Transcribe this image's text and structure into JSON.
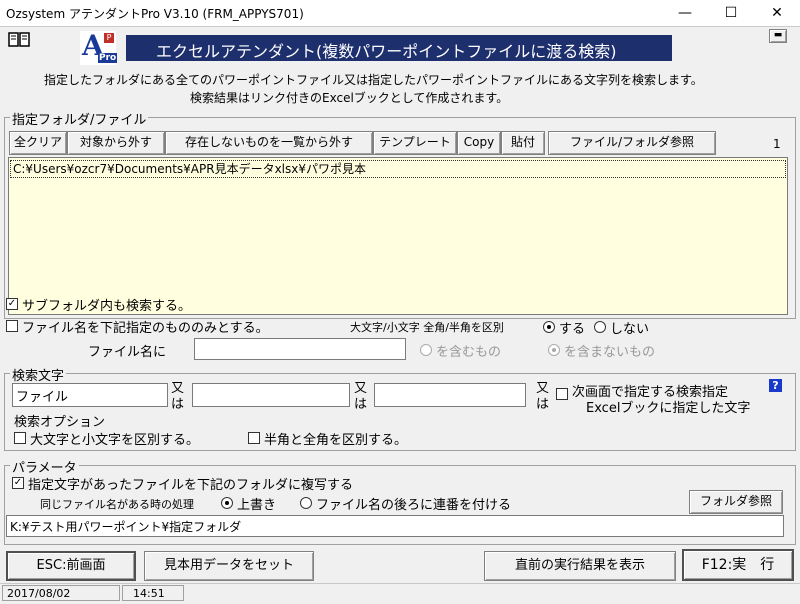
{
  "window": {
    "title": "Ozsystem アテンダントPro V3.10 (FRM_APPYS701)"
  },
  "header": {
    "logo_letter": "A",
    "logo_sub": "Pro",
    "banner": "エクセルアテンダント(複数パワーポイントファイルに渡る検索)",
    "desc1": "指定したフォルダにある全てのパワーポイントファイル又は指定したパワーポイントファイルにある文字列を検索します。",
    "desc2": "検索結果はリンク付きのExcelブックとして作成されます。"
  },
  "folder_group": {
    "label": "指定フォルダ/ファイル",
    "buttons": [
      "全クリア",
      "対象から外す",
      "存在しないものを一覧から外す",
      "テンプレート",
      "Copy",
      "貼付",
      "ファイル/フォルダ参照"
    ],
    "count": "1",
    "paths": [
      "C:¥Users¥ozcr7¥Documents¥APR見本データxlsx¥パワポ見本"
    ]
  },
  "options": {
    "subfolder": "サブフォルダ内も検索する。",
    "filename_only": "ファイル名を下記指定のもののみとする。",
    "case_label": "大文字/小文字 全角/半角を区別",
    "yes": "する",
    "no": "しない",
    "filename_label": "ファイル名に",
    "filename_value": "",
    "include": "を含むもの",
    "exclude": "を含まないもの"
  },
  "search_group": {
    "label": "検索文字",
    "term1": "ファイル",
    "term2": "",
    "term3": "",
    "or1": "又",
    "or2": "は",
    "next_screen": "次画面で指定する検索指定",
    "excel_book": "Excelブックに指定した文字",
    "help": "?",
    "options_label": "検索オプション",
    "case_sensitive": "大文字と小文字を区別する。",
    "width_sensitive": "半角と全角を区別する。"
  },
  "param_group": {
    "label": "パラメータ",
    "copy_files": "指定文字があったファイルを下記のフォルダに複写する",
    "same_name": "同じファイル名がある時の処理",
    "overwrite": "上書き",
    "append": "ファイル名の後ろに連番を付ける",
    "folder_btn": "フォルダ参照",
    "dest": "K:¥テスト用パワーポイント¥指定フォルダ"
  },
  "footer": {
    "esc": "ESC:前画面",
    "sample": "見本用データをセット",
    "prev_result": "直前の実行結果を表示",
    "run": "F12:実　行",
    "date": "2017/08/02",
    "time": "14:51"
  }
}
